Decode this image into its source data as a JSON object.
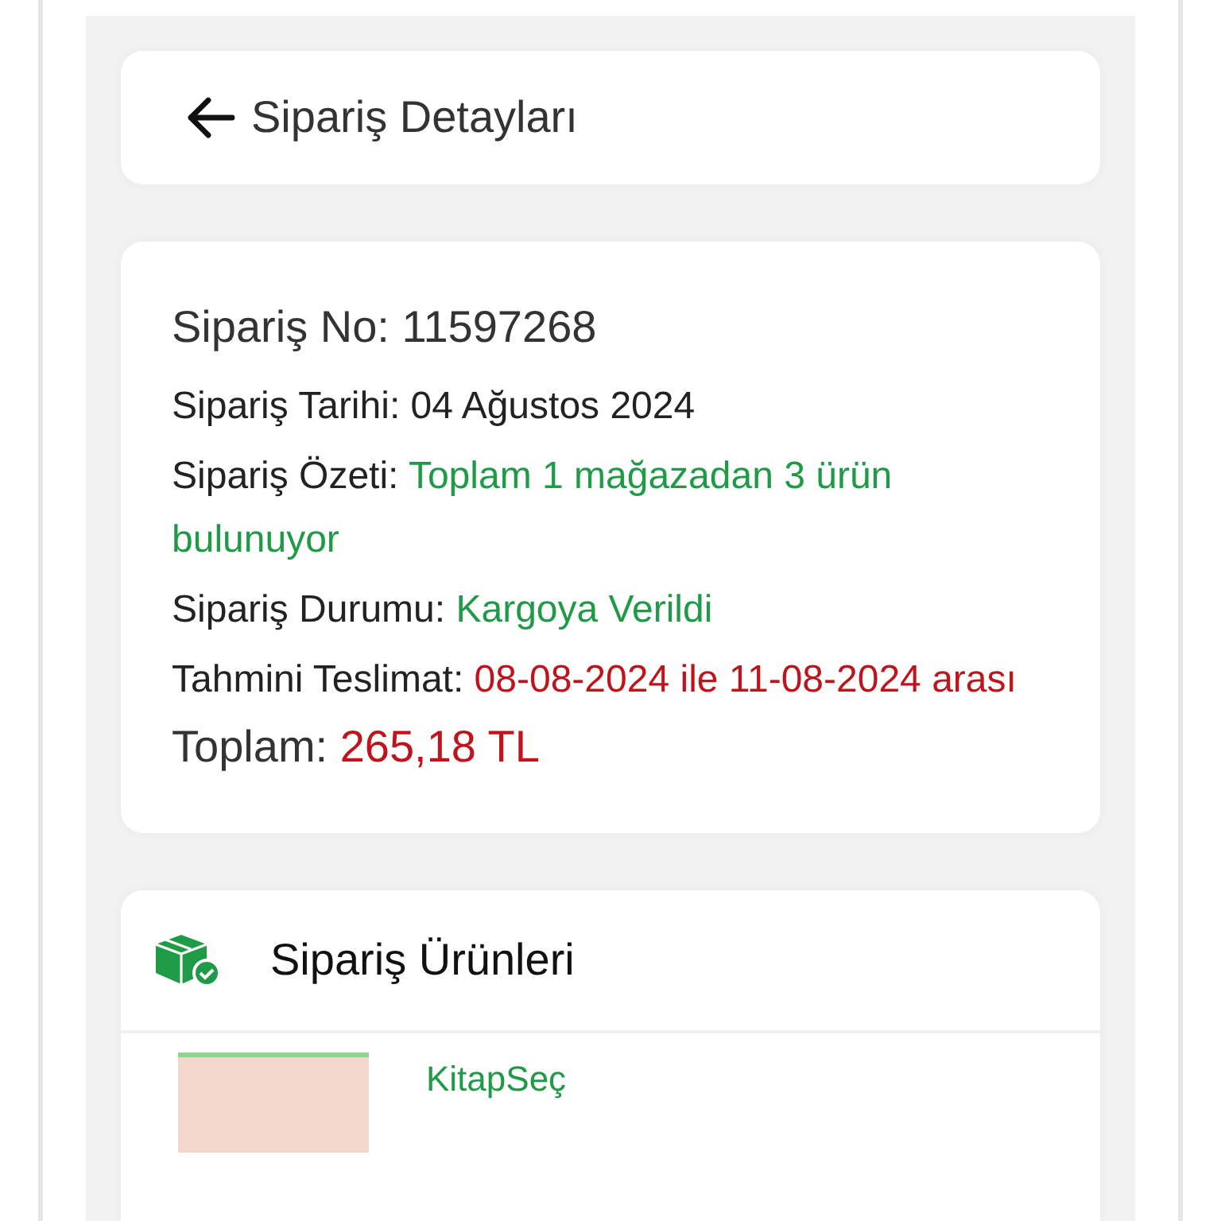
{
  "header": {
    "title": "Sipariş Detayları"
  },
  "order": {
    "number": {
      "label": "Sipariş No:",
      "value": "11597268"
    },
    "fields": [
      {
        "label": "Sipariş Tarihi:",
        "value": "04 Ağustos 2024",
        "kind": "plain"
      },
      {
        "label": "Sipariş Özeti:",
        "value": "Toplam 1 mağazadan 3 ürün bulunuyor",
        "kind": "success"
      },
      {
        "label": "Sipariş Durumu:",
        "value": "Kargoya Verildi",
        "kind": "success"
      },
      {
        "label": "Tahmini Teslimat:",
        "value": "08-08-2024 ile 11-08-2024 arası",
        "kind": "danger"
      }
    ],
    "total": {
      "label": "Toplam:",
      "value": "265,18 TL"
    }
  },
  "products": {
    "title": "Sipariş Ürünleri",
    "items": [
      {
        "store": "KitapSeç"
      }
    ]
  }
}
